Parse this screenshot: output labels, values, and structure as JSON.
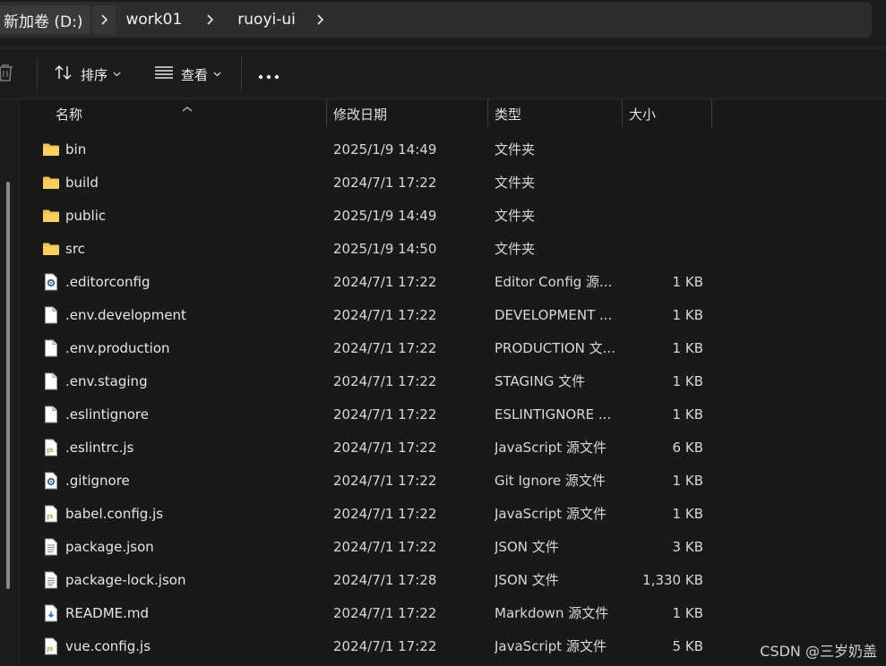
{
  "breadcrumb": {
    "items": [
      "新加卷 (D:)",
      "work01",
      "ruoyi-ui"
    ]
  },
  "toolbar": {
    "sort_label": "排序",
    "view_label": "查看"
  },
  "columns": {
    "name": "名称",
    "date": "修改日期",
    "type": "类型",
    "size": "大小"
  },
  "rows": [
    {
      "name": "bin",
      "date": "2025/1/9 14:49",
      "type": "文件夹",
      "size": "",
      "icon": "folder-icon"
    },
    {
      "name": "build",
      "date": "2024/7/1 17:22",
      "type": "文件夹",
      "size": "",
      "icon": "folder-icon"
    },
    {
      "name": "public",
      "date": "2025/1/9 14:49",
      "type": "文件夹",
      "size": "",
      "icon": "folder-icon"
    },
    {
      "name": "src",
      "date": "2025/1/9 14:50",
      "type": "文件夹",
      "size": "",
      "icon": "folder-icon"
    },
    {
      "name": ".editorconfig",
      "date": "2024/7/1 17:22",
      "type": "Editor Config 源...",
      "size": "1 KB",
      "icon": "config-file-icon"
    },
    {
      "name": ".env.development",
      "date": "2024/7/1 17:22",
      "type": "DEVELOPMENT ...",
      "size": "1 KB",
      "icon": "file-icon"
    },
    {
      "name": ".env.production",
      "date": "2024/7/1 17:22",
      "type": "PRODUCTION 文...",
      "size": "1 KB",
      "icon": "file-icon"
    },
    {
      "name": ".env.staging",
      "date": "2024/7/1 17:22",
      "type": "STAGING 文件",
      "size": "1 KB",
      "icon": "file-icon"
    },
    {
      "name": ".eslintignore",
      "date": "2024/7/1 17:22",
      "type": "ESLINTIGNORE ...",
      "size": "1 KB",
      "icon": "file-icon"
    },
    {
      "name": ".eslintrc.js",
      "date": "2024/7/1 17:22",
      "type": "JavaScript 源文件",
      "size": "6 KB",
      "icon": "js-file-icon"
    },
    {
      "name": ".gitignore",
      "date": "2024/7/1 17:22",
      "type": "Git Ignore 源文件",
      "size": "1 KB",
      "icon": "config-file-icon"
    },
    {
      "name": "babel.config.js",
      "date": "2024/7/1 17:22",
      "type": "JavaScript 源文件",
      "size": "1 KB",
      "icon": "js-file-icon"
    },
    {
      "name": "package.json",
      "date": "2024/7/1 17:22",
      "type": "JSON 文件",
      "size": "3 KB",
      "icon": "json-file-icon"
    },
    {
      "name": "package-lock.json",
      "date": "2024/7/1 17:28",
      "type": "JSON 文件",
      "size": "1,330 KB",
      "icon": "json-file-icon"
    },
    {
      "name": "README.md",
      "date": "2024/7/1 17:22",
      "type": "Markdown 源文件",
      "size": "1 KB",
      "icon": "markdown-file-icon"
    },
    {
      "name": "vue.config.js",
      "date": "2024/7/1 17:22",
      "type": "JavaScript 源文件",
      "size": "5 KB",
      "icon": "js-file-icon"
    }
  ],
  "watermark": "CSDN @三岁奶盖",
  "colors": {
    "background": "#191919",
    "folder": "#f2c14e",
    "text": "#e6e6e6"
  }
}
